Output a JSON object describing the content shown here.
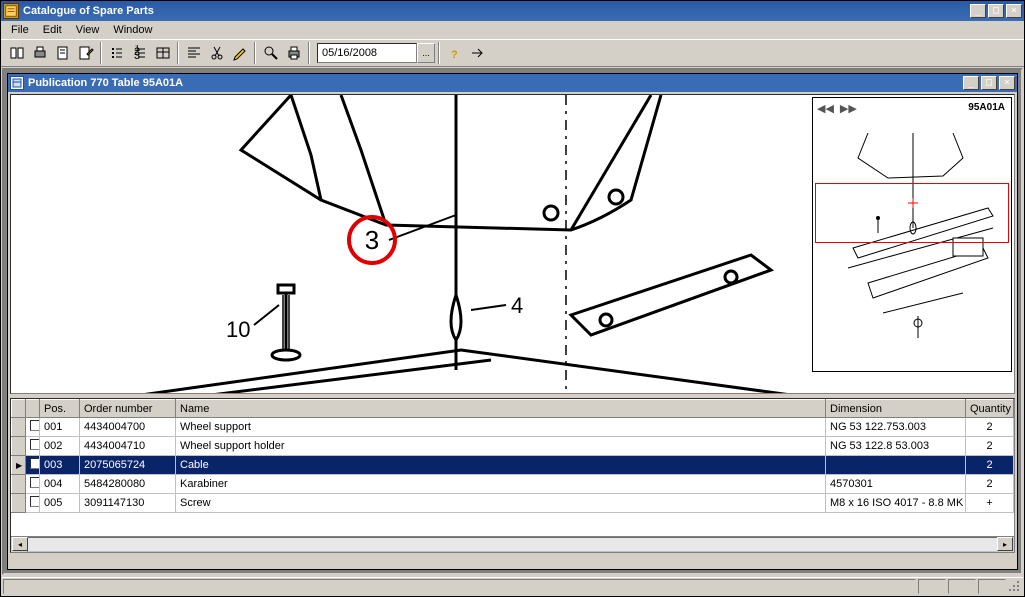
{
  "app": {
    "title": "Catalogue of Spare Parts"
  },
  "menu": {
    "file": "File",
    "edit": "Edit",
    "view": "View",
    "window": "Window"
  },
  "toolbar": {
    "date_value": "05/16/2008",
    "date_picker_label": "..."
  },
  "child_window": {
    "title": "Publication 770 Table 95A01A"
  },
  "drawing": {
    "highlighted_callout": "3",
    "callouts": {
      "c10": "10",
      "c4": "4"
    },
    "overview_label": "95A01A"
  },
  "table": {
    "headers": {
      "pos": "Pos.",
      "order": "Order number",
      "name": "Name",
      "dimension": "Dimension",
      "quantity": "Quantity"
    },
    "rows": [
      {
        "pos": "001",
        "order": "4434004700",
        "name": "Wheel support",
        "dimension": "NG 53 122.753.003",
        "qty": "2",
        "selected": false
      },
      {
        "pos": "002",
        "order": "4434004710",
        "name": "Wheel support holder",
        "dimension": "NG 53 122.8 53.003",
        "qty": "2",
        "selected": false
      },
      {
        "pos": "003",
        "order": "2075065724",
        "name": "Cable",
        "dimension": "",
        "qty": "2",
        "selected": true
      },
      {
        "pos": "004",
        "order": "5484280080",
        "name": "Karabiner",
        "dimension": "4570301",
        "qty": "2",
        "selected": false
      },
      {
        "pos": "005",
        "order": "3091147130",
        "name": "Screw",
        "dimension": "M8 x 16 ISO 4017 - 8.8 MK",
        "qty": "+",
        "selected": false
      }
    ]
  }
}
